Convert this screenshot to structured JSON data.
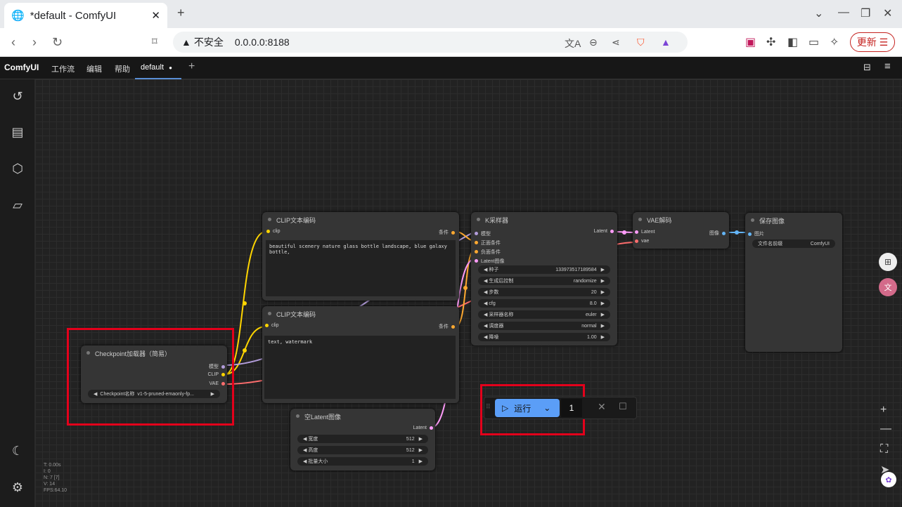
{
  "browser": {
    "tab_title": "*default - ComfyUI",
    "tab_close": "✕",
    "new_tab": "+",
    "security_label": "不安全",
    "url": "0.0.0.0:8188",
    "update_label": "更新"
  },
  "menu": {
    "brand": "ComfyUI",
    "items": [
      "工作流",
      "编辑",
      "帮助"
    ],
    "workflow_tab": "default",
    "modified_marker": "●",
    "add_tab": "+"
  },
  "nodes": {
    "clip1": {
      "title": "CLIP文本编码",
      "in": "clip",
      "out": "条件",
      "text": "beautiful scenery nature glass bottle landscape, blue galaxy bottle,"
    },
    "clip2": {
      "title": "CLIP文本编码",
      "in": "clip",
      "out": "条件",
      "text": "text, watermark"
    },
    "ksampler": {
      "title": "K采样器",
      "inputs": [
        "模型",
        "正面条件",
        "负面条件",
        "Latent图像"
      ],
      "out": "Latent",
      "widgets": [
        [
          "种子",
          "133973517189584"
        ],
        [
          "生成后控制",
          "randomize"
        ],
        [
          "步数",
          "20"
        ],
        [
          "cfg",
          "8.0"
        ],
        [
          "采样器名称",
          "euler"
        ],
        [
          "调度器",
          "normal"
        ],
        [
          "降噪",
          "1.00"
        ]
      ]
    },
    "vae": {
      "title": "VAE解码",
      "inputs": [
        "Latent",
        "vae"
      ],
      "out": "图像"
    },
    "save": {
      "title": "保存图像",
      "in": "图片",
      "widget_label": "文件名前缀",
      "widget_value": "ComfyUI"
    },
    "ckpt": {
      "title": "Checkpoint加载器（简易）",
      "outputs": [
        "模型",
        "CLIP",
        "VAE"
      ],
      "widget_label": "Checkpoint名称",
      "widget_value": "v1-5-pruned-emaonly-fp..."
    },
    "latent": {
      "title": "空Latent图像",
      "out": "Latent",
      "widgets": [
        [
          "宽度",
          "512"
        ],
        [
          "高度",
          "512"
        ],
        [
          "批量大小",
          "1"
        ]
      ]
    }
  },
  "stats": "T: 0.00s\nI: 0\nN: 7 [7]\nV: 14\nFPS:64.10",
  "run": {
    "label": "运行",
    "batch": "1"
  },
  "colors": {
    "clip": "#ffd500",
    "conditioning": "#ffa931",
    "model": "#b39ddb",
    "latent": "#ff9cf9",
    "vae": "#ff6e6e",
    "image": "#64b5f6",
    "highlight": "#e3001b"
  }
}
